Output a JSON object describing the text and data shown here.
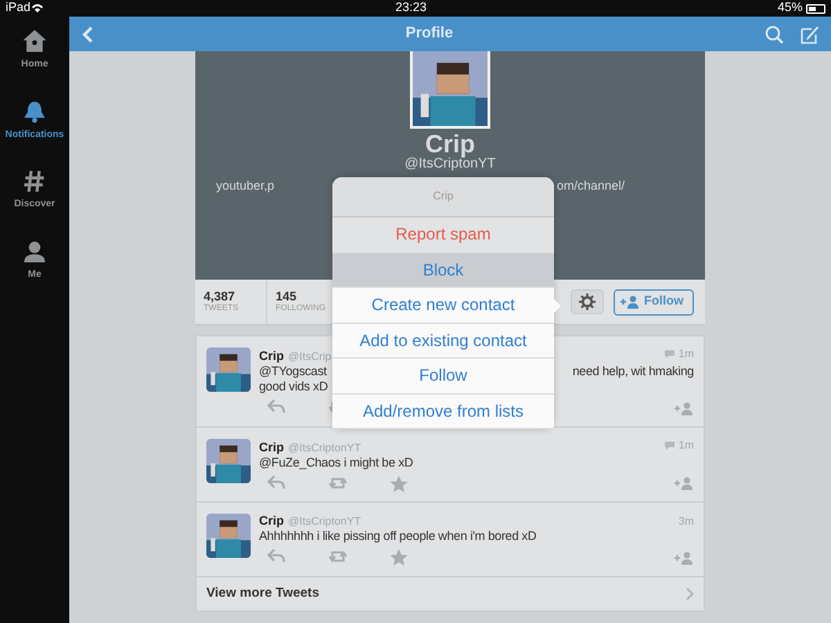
{
  "status_bar": {
    "device": "iPad",
    "time": "23:23",
    "battery": "45%"
  },
  "sidebar": {
    "items": [
      {
        "label": "Home",
        "kind": "home",
        "selected": false
      },
      {
        "label": "Notifications",
        "kind": "bell",
        "selected": true
      },
      {
        "label": "Discover",
        "kind": "hash",
        "selected": false
      },
      {
        "label": "Me",
        "kind": "person",
        "selected": false
      }
    ]
  },
  "nav": {
    "title": "Profile"
  },
  "profile": {
    "name": "Crip",
    "handle": "@ItsCriptonYT",
    "bio_left": "youtuber,p",
    "bio_right": "om/channel/",
    "stats": [
      {
        "value": "4,387",
        "label": "TWEETS"
      },
      {
        "value": "145",
        "label": "FOLLOWING"
      }
    ],
    "follow_button": "Follow"
  },
  "tweets": [
    {
      "name": "Crip",
      "handle": "@ItsCrip",
      "time": "1m",
      "conversation": true,
      "text_left": [
        "@TYogscast",
        "good vids xD"
      ],
      "text_right": [
        "need help, wit hmaking"
      ],
      "actions": [
        {
          "kind": "reply"
        },
        {
          "kind": "retweet"
        }
      ]
    },
    {
      "name": "Crip",
      "handle": "@ItsCriptonYT",
      "time": "1m",
      "conversation": true,
      "text_left": [
        "@FuZe_Chaos i might be xD"
      ],
      "actions": [
        {
          "kind": "reply"
        },
        {
          "kind": "retweet"
        },
        {
          "kind": "favorite"
        }
      ]
    },
    {
      "name": "Crip",
      "handle": "@ItsCriptonYT",
      "time": "3m",
      "conversation": false,
      "text_left": [
        "Ahhhhhhh i like pissing off people when i'm bored xD"
      ],
      "actions": [
        {
          "kind": "reply"
        },
        {
          "kind": "retweet"
        },
        {
          "kind": "favorite"
        }
      ]
    }
  ],
  "view_more": "View more Tweets",
  "popover": {
    "title": "Crip",
    "items": [
      {
        "label": "Report spam",
        "kind": "destructive",
        "selected": false
      },
      {
        "label": "Block",
        "kind": "normal",
        "selected": true
      },
      {
        "label": "Create new contact",
        "kind": "normal",
        "selected": false
      },
      {
        "label": "Add to existing contact",
        "kind": "normal",
        "selected": false
      },
      {
        "label": "Follow",
        "kind": "normal",
        "selected": false
      },
      {
        "label": "Add/remove from lists",
        "kind": "normal",
        "selected": false
      }
    ]
  }
}
